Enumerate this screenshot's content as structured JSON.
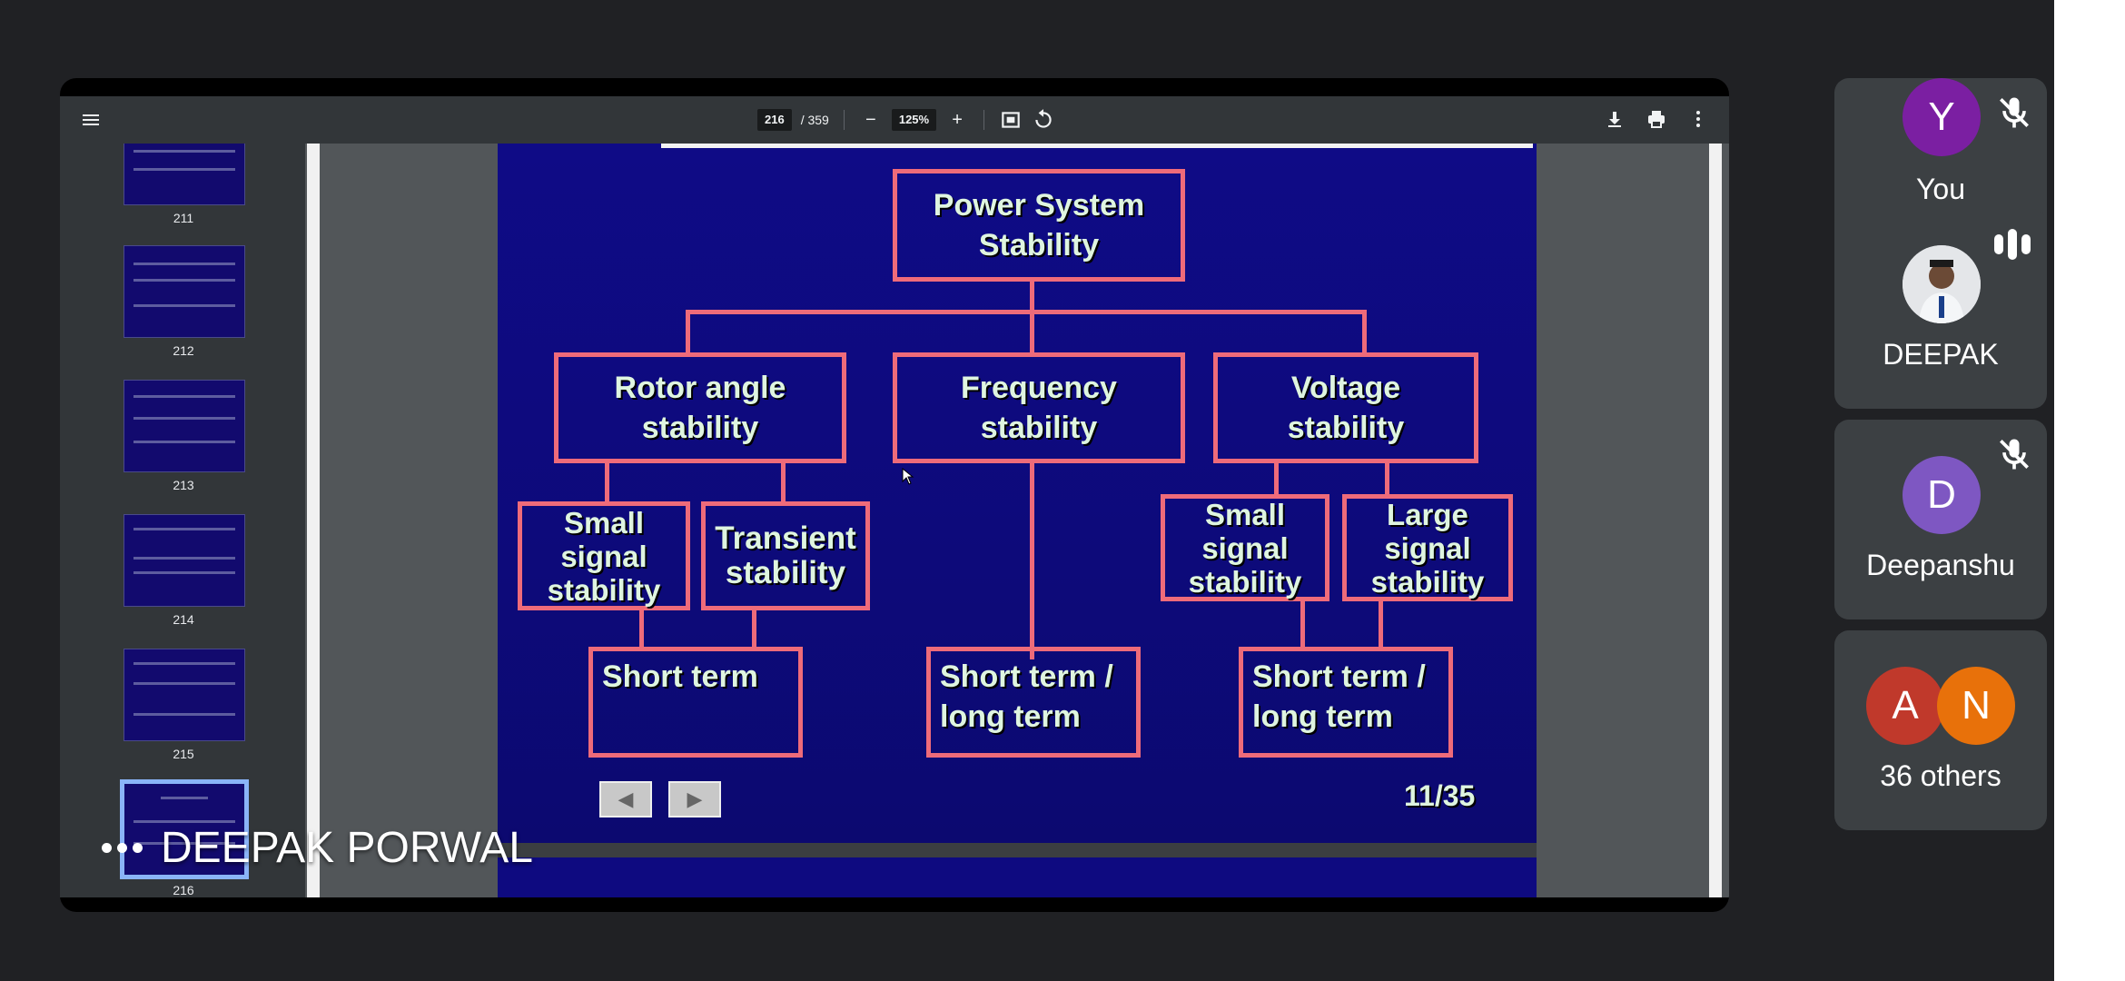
{
  "viewer": {
    "page_current": "216",
    "page_separator": "/ 359",
    "zoom": "125%"
  },
  "thumbnails": [
    {
      "num": "211"
    },
    {
      "num": "212"
    },
    {
      "num": "213"
    },
    {
      "num": "214"
    },
    {
      "num": "215"
    },
    {
      "num": "216"
    }
  ],
  "slide": {
    "root": "Power System\nStability",
    "rotor": "Rotor angle\nstability",
    "frequency": "Frequency\nstability",
    "voltage": "Voltage\nstability",
    "small_signal_1": "Small\nsignal\nstability",
    "transient": "Transient\nstability",
    "small_signal_2": "Small\nsignal\nstability",
    "large_signal": "Large\nsignal\nstability",
    "short_term": "Short term",
    "short_long_1": "Short term /\nlong term",
    "short_long_2": "Short term /\nlong term",
    "counter": "11/35"
  },
  "presenter": {
    "name": "DEEPAK PORWAL"
  },
  "participants": [
    {
      "initial": "Y",
      "name": "You",
      "color": "#7b1fa2",
      "muted": true
    },
    {
      "initial": "",
      "name": "DEEPAK",
      "speaking": true
    },
    {
      "initial": "D",
      "name": "Deepanshu",
      "color": "#7e57c2",
      "muted": true
    },
    {
      "initials": [
        "A",
        "N"
      ],
      "name": "36 others",
      "colors": [
        "#c0392b",
        "#e8710a"
      ]
    }
  ]
}
